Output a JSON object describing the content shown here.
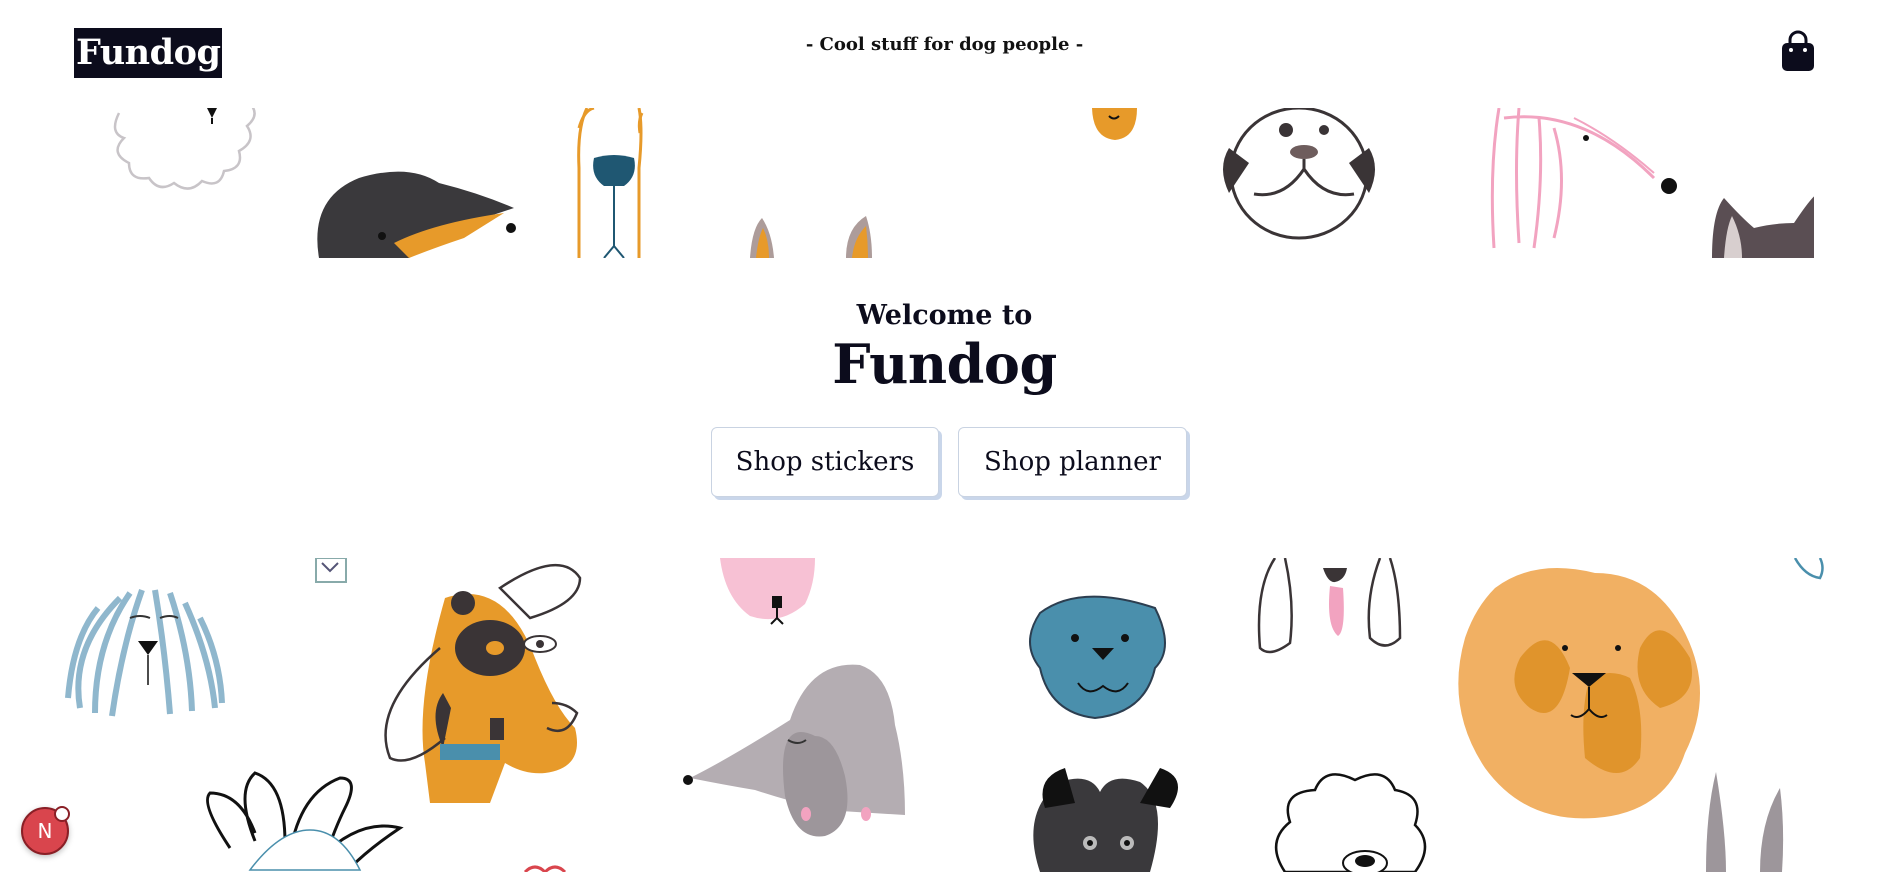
{
  "header": {
    "logo": "Fundog",
    "tagline": "- Cool stuff for dog people -",
    "cart_icon": "shopping-bag-icon"
  },
  "hero": {
    "welcome": "Welcome to",
    "title": "Fundog",
    "buttons": [
      {
        "label": "Shop stickers"
      },
      {
        "label": "Shop planner"
      }
    ]
  },
  "badge": {
    "letter": "N"
  },
  "colors": {
    "navy": "#0c0c1c",
    "orange": "#e79a2a",
    "teal": "#4a8fac",
    "pink": "#f2a3c0",
    "grey": "#b4adb2",
    "badge_red": "#d9454d"
  }
}
